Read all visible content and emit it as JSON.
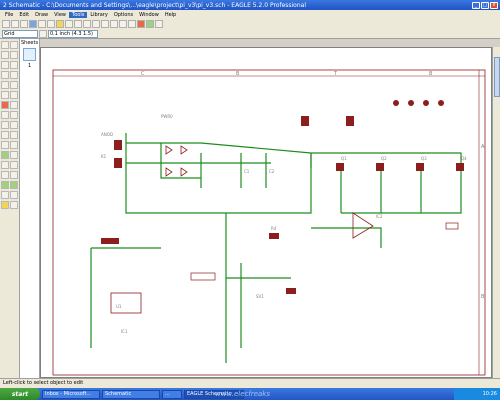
{
  "window": {
    "title": "2 Schematic - C:\\Documents and Settings\\...\\eagle\\project\\pi_v3\\pi_v3.sch - EAGLE 5.2.0 Professional",
    "buttons": [
      "_",
      "□",
      "x"
    ]
  },
  "menu": {
    "items": [
      "File",
      "Edit",
      "Draw",
      "View",
      "Tools",
      "Library",
      "Options",
      "Window",
      "Help"
    ],
    "active_index": 4
  },
  "toolbar": {
    "layer_field": "Grid",
    "coordinate": "0.1 inch (4.3 1.5)"
  },
  "layers": {
    "label": "Sheets",
    "sheet_number": "1"
  },
  "schematic": {
    "frame_letters": [
      "C",
      "B",
      "T",
      "B"
    ],
    "row_letters": [
      "A",
      "B"
    ],
    "labels": [
      "PWR0",
      "ANOD",
      "K1",
      "C1",
      "C2",
      "U1",
      "IC2",
      "Q1",
      "Q2",
      "Q3",
      "Q4",
      "R4",
      "SV1",
      "IC1"
    ],
    "colors": {
      "wire": "#1e8c1e",
      "part": "#8c1e1e",
      "frame": "#8c1e1e",
      "text": "#7f7f7f"
    }
  },
  "status": {
    "text": "Left-click to select object to edit"
  },
  "taskbar": {
    "start": "start",
    "tasks": [
      "Inbox - Microsoft...",
      "Schematic",
      "...",
      "EAGLE Schematic"
    ],
    "clock": "10:26"
  },
  "watermark": "www.elecfreaks"
}
